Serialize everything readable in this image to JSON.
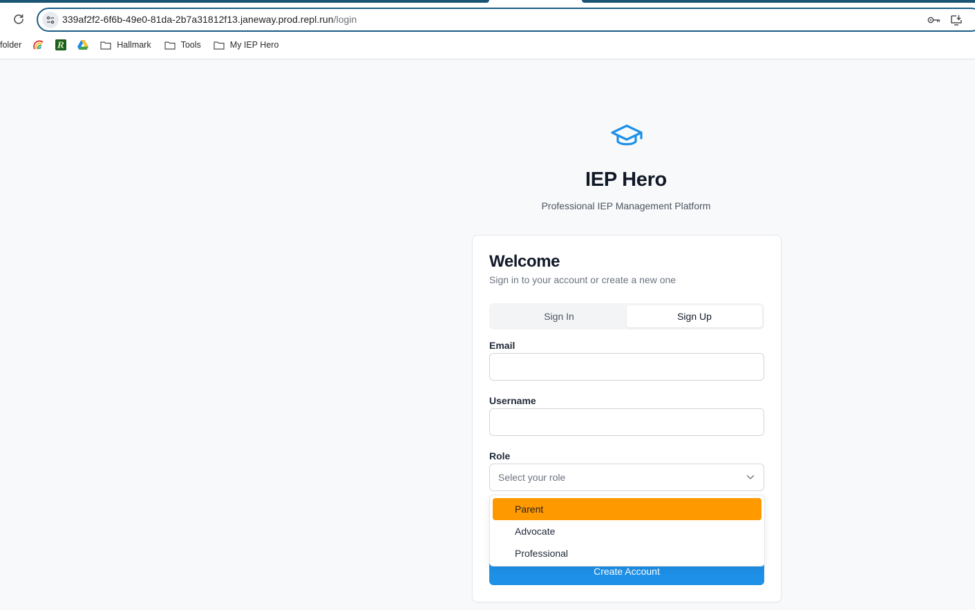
{
  "browser": {
    "url_host": "339af2f2-6f6b-49e0-81da-2b7a31812f13.janeway.prod.repl.run",
    "url_path": "/login",
    "bookmarks": [
      {
        "label": "folder",
        "icon": "folder-truncated"
      },
      {
        "label": "",
        "icon": "rainbow-app-icon"
      },
      {
        "label": "",
        "icon": "r-app-icon"
      },
      {
        "label": "",
        "icon": "google-drive-icon"
      },
      {
        "label": "Hallmark",
        "icon": "folder-icon"
      },
      {
        "label": "Tools",
        "icon": "folder-icon"
      },
      {
        "label": "My IEP Hero",
        "icon": "folder-icon"
      }
    ]
  },
  "app": {
    "title": "IEP Hero",
    "subtitle": "Professional IEP Management Platform",
    "logo_icon": "graduation-cap-icon",
    "accent_color": "#1e90e8"
  },
  "card": {
    "title": "Welcome",
    "description": "Sign in to your account or create a new one",
    "tabs": {
      "signin": "Sign In",
      "signup": "Sign Up",
      "active": "Sign Up"
    },
    "fields": {
      "email_label": "Email",
      "username_label": "Username",
      "role_label": "Role",
      "role_placeholder": "Select your role"
    },
    "submit_label": "Create Account"
  },
  "dropdown": {
    "options": [
      "Parent",
      "Advocate",
      "Professional"
    ],
    "highlighted": "Parent",
    "highlight_color": "#ff9900"
  }
}
